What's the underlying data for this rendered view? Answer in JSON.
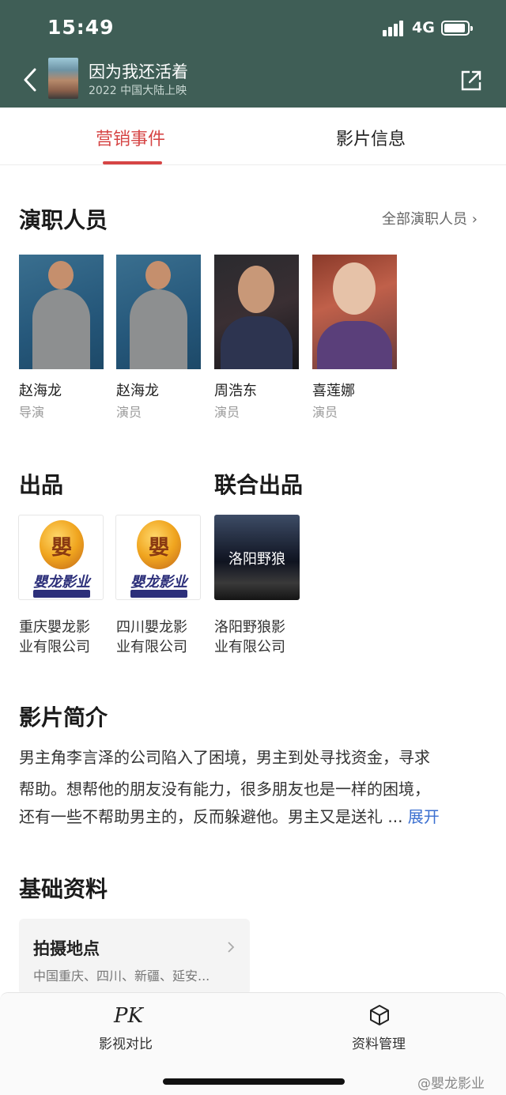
{
  "status_bar": {
    "time": "15:49",
    "network": "4G"
  },
  "header": {
    "title": "因为我还活着",
    "subtitle": "2022 中国大陆上映"
  },
  "tabs": [
    {
      "label": "营销事件",
      "active": true
    },
    {
      "label": "影片信息",
      "active": false
    }
  ],
  "cast": {
    "title": "演职人员",
    "more_label": "全部演职人员",
    "people": [
      {
        "name": "赵海龙",
        "role": "导演"
      },
      {
        "name": "赵海龙",
        "role": "演员"
      },
      {
        "name": "周浩东",
        "role": "演员"
      },
      {
        "name": "喜莲娜",
        "role": "演员"
      }
    ]
  },
  "production": {
    "title": "出品",
    "co_title": "联合出品",
    "logo_text": "嬰龙影业",
    "logo_mark": "嬰",
    "dark_logo_text": "洛阳野狼",
    "companies": [
      {
        "line1": "重庆嬰龙影",
        "line2": "业有限公司"
      },
      {
        "line1": "四川嬰龙影",
        "line2": "业有限公司"
      },
      {
        "line1": "洛阳野狼影",
        "line2": "业有限公司"
      }
    ]
  },
  "synopsis": {
    "title": "影片简介",
    "lines": [
      "男主角李言泽的公司陷入了困境，男主到处寻找资金，寻求",
      "帮助。想帮他的朋友没有能力，很多朋友也是一样的困境，",
      "还有一些不帮助男主的，反而躲避他。男主又是送礼 ..."
    ],
    "expand_label": "展开"
  },
  "basic_info": {
    "title": "基础资料",
    "card_label": "拍摄地点",
    "card_value": "中国重庆、四川、新疆、延安..."
  },
  "bottom_bar": {
    "pk_icon": "PK",
    "pk_label": "影视对比",
    "manage_label": "资料管理"
  },
  "watermark": "@嬰龙影业",
  "colors": {
    "header_bg": "#3f5e56",
    "accent_red": "#d64545",
    "link_blue": "#3b6fd0"
  }
}
